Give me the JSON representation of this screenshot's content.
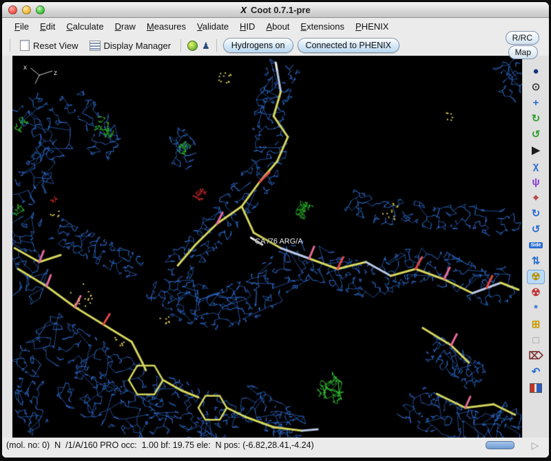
{
  "window": {
    "title": "Coot 0.7.1-pre",
    "x11_logo": "X"
  },
  "menu": {
    "items": [
      {
        "label": "File"
      },
      {
        "label": "Edit"
      },
      {
        "label": "Calculate"
      },
      {
        "label": "Draw"
      },
      {
        "label": "Measures"
      },
      {
        "label": "Validate"
      },
      {
        "label": "HID"
      },
      {
        "label": "About"
      },
      {
        "label": "Extensions"
      },
      {
        "label": "PHENIX"
      }
    ]
  },
  "toolbar": {
    "reset_view": "Reset View",
    "display_manager": "Display Manager",
    "hydrogens": "Hydrogens on",
    "connected": "Connected to PHENIX"
  },
  "side": {
    "rrc": "R/RC",
    "map": "Map",
    "tools": [
      {
        "name": "sphere-tool-icon",
        "glyph": "●",
        "color": "#16337f"
      },
      {
        "name": "history-tool-icon",
        "glyph": "⊙",
        "color": "#3a3a3a"
      },
      {
        "name": "rot-trans-zone-icon",
        "glyph": "+",
        "color": "#2b6fd0"
      },
      {
        "name": "real-space-refine-icon",
        "glyph": "↻",
        "color": "#2f9e2f"
      },
      {
        "name": "regularize-zone-icon",
        "glyph": "↺",
        "color": "#2f9e2f"
      },
      {
        "name": "run-tool-icon",
        "glyph": "▶",
        "color": "#1c1c1c"
      },
      {
        "name": "rotamers-icon",
        "glyph": "χ",
        "color": "#2b6fd0"
      },
      {
        "name": "edit-chi-angles-icon",
        "glyph": "ψ",
        "color": "#8a3fd0"
      },
      {
        "name": "auto-fit-rotamer-icon",
        "glyph": "⌖",
        "color": "#b03030"
      },
      {
        "name": "cycle-forward-icon",
        "glyph": "↻",
        "color": "#2b6fd0"
      },
      {
        "name": "cycle-back-icon",
        "glyph": "↺",
        "color": "#2b6fd0"
      },
      {
        "name": "side-chain-flip-icon",
        "kind": "chip",
        "text": "Side"
      },
      {
        "name": "flip-peptide-icon",
        "glyph": "⇅",
        "color": "#2b6fd0"
      },
      {
        "name": "refine-active-icon",
        "glyph": "☢",
        "color": "#b8930c",
        "active": true
      },
      {
        "name": "radiation-red-icon",
        "glyph": "☢",
        "color": "#c03030"
      },
      {
        "name": "regularize-atoms-icon",
        "glyph": "*",
        "color": "#2b6fd0"
      },
      {
        "name": "add-terminal-residue-icon",
        "glyph": "⊞",
        "color": "#c79a00"
      },
      {
        "name": "blank-tool-icon",
        "glyph": "□",
        "color": "#909090"
      },
      {
        "name": "delete-item-icon",
        "glyph": "⌦",
        "color": "#7a2f2f"
      },
      {
        "name": "undo-tool-icon",
        "glyph": "↶",
        "color": "#2b6fd0"
      },
      {
        "name": "screenshot-flag-icon",
        "kind": "flag"
      }
    ]
  },
  "canvas": {
    "residue_label": "CA /76 ARG/A",
    "axis_x": "x",
    "axis_z": "z",
    "colors": {
      "map_2fofc": "#2e6fd2",
      "model_carbon": "#d4d45e",
      "diff_positive": "#2db32d",
      "diff_negative": "#cc2b2b",
      "background": "#000000"
    }
  },
  "statusbar": {
    "text": "(mol. no: 0)  N  /1/A/160 PRO occ:  1.00 bf: 19.75 ele:  N pos: (-6.82,28.41,-4.24)",
    "expand_glyph": "▷"
  }
}
